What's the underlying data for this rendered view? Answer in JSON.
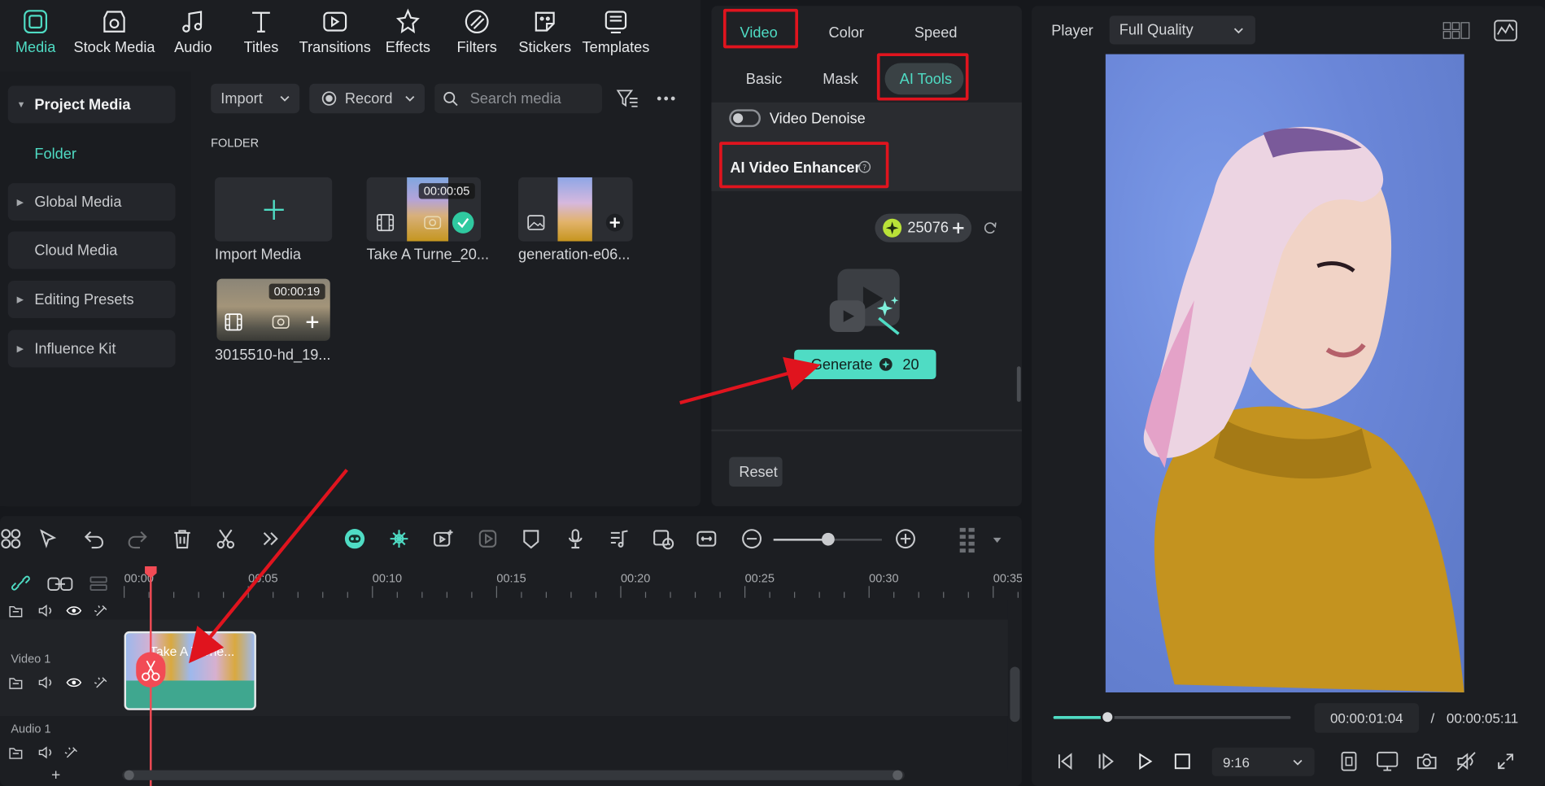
{
  "media_tabs": [
    {
      "label": "Media",
      "icon": "media-icon",
      "active": true
    },
    {
      "label": "Stock Media",
      "icon": "stock-media-icon"
    },
    {
      "label": "Audio",
      "icon": "audio-icon"
    },
    {
      "label": "Titles",
      "icon": "titles-icon"
    },
    {
      "label": "Transitions",
      "icon": "transitions-icon"
    },
    {
      "label": "Effects",
      "icon": "effects-icon"
    },
    {
      "label": "Filters",
      "icon": "filters-icon"
    },
    {
      "label": "Stickers",
      "icon": "stickers-icon"
    },
    {
      "label": "Templates",
      "icon": "templates-icon"
    }
  ],
  "sidebar": {
    "project_media": "Project Media",
    "folder": "Folder",
    "global_media": "Global Media",
    "cloud_media": "Cloud Media",
    "editing_presets": "Editing Presets",
    "influence_kit": "Influence Kit"
  },
  "toolbar": {
    "import_label": "Import",
    "record_label": "Record",
    "search_placeholder": "Search media"
  },
  "folder_heading": "FOLDER",
  "media_items": [
    {
      "caption": "Import Media"
    },
    {
      "caption": "Take A Turne_20...",
      "duration": "00:00:05"
    },
    {
      "caption": "generation-e06..."
    },
    {
      "caption": "3015510-hd_19...",
      "duration": "00:00:19"
    }
  ],
  "props": {
    "tabs": [
      "Video",
      "Color",
      "Speed"
    ],
    "subtabs": [
      "Basic",
      "Mask",
      "AI Tools"
    ],
    "video_denoise": "Video Denoise",
    "ai_video_enhancer": "AI Video Enhancer",
    "credits": "25076",
    "generate_label": "Generate",
    "generate_cost": "20",
    "reset_label": "Reset"
  },
  "player": {
    "label": "Player",
    "quality": "Full Quality",
    "current_time": "00:00:01:04",
    "separator": "/",
    "total_time": "00:00:05:11",
    "aspect": "9:16",
    "progress": 0.23
  },
  "timeline": {
    "ruler": [
      "00:00",
      "00:05",
      "00:10",
      "00:15",
      "00:20",
      "00:25",
      "00:30",
      "00:35"
    ],
    "tracks": [
      "Video 1",
      "Audio 1"
    ],
    "clip_label": "Take A Turne...",
    "add_track": "+"
  },
  "colors": {
    "accent": "#4fdcc4",
    "highlight": "#e0141e",
    "playhead": "#f24b55"
  }
}
